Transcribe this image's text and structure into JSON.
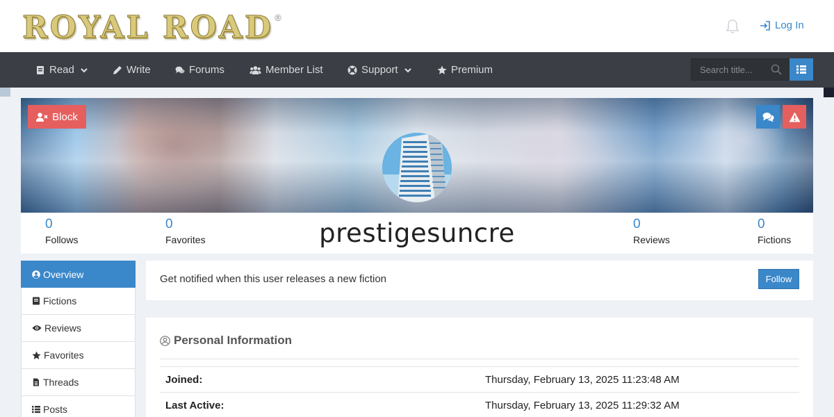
{
  "brand": {
    "logo_text": "ROYAL ROAD",
    "registered": "®"
  },
  "header": {
    "login_label": "Log In"
  },
  "nav": {
    "items": [
      {
        "label": "Read",
        "icon": "book-icon",
        "dropdown": true
      },
      {
        "label": "Write",
        "icon": "pencil-icon",
        "dropdown": false
      },
      {
        "label": "Forums",
        "icon": "comments-icon",
        "dropdown": false
      },
      {
        "label": "Member List",
        "icon": "users-icon",
        "dropdown": false
      },
      {
        "label": "Support",
        "icon": "life-ring-icon",
        "dropdown": true
      },
      {
        "label": "Premium",
        "icon": "star-icon",
        "dropdown": false
      }
    ],
    "search_placeholder": "Search title..."
  },
  "profile": {
    "block_label": "Block",
    "username": "prestigesuncre",
    "stats": {
      "follows": {
        "value": "0",
        "label": "Follows"
      },
      "favorites": {
        "value": "0",
        "label": "Favorites"
      },
      "reviews": {
        "value": "0",
        "label": "Reviews"
      },
      "fictions": {
        "value": "0",
        "label": "Fictions"
      }
    }
  },
  "sidebar": {
    "items": [
      {
        "label": "Overview",
        "icon": "user-circle-icon",
        "active": true
      },
      {
        "label": "Fictions",
        "icon": "book-icon",
        "active": false
      },
      {
        "label": "Reviews",
        "icon": "eye-icon",
        "active": false
      },
      {
        "label": "Favorites",
        "icon": "star-icon",
        "active": false
      },
      {
        "label": "Threads",
        "icon": "file-icon",
        "active": false
      },
      {
        "label": "Posts",
        "icon": "list-icon",
        "active": false
      }
    ]
  },
  "notify": {
    "text": "Get notified when this user releases a new fiction",
    "follow_label": "Follow"
  },
  "personal_info": {
    "title": "Personal Information",
    "rows": [
      {
        "key": "Joined:",
        "value": "Thursday, February 13, 2025 11:23:48 AM"
      },
      {
        "key": "Last Active:",
        "value": "Thursday, February 13, 2025 11:29:32 AM"
      }
    ]
  },
  "colors": {
    "accent": "#3a87c9",
    "danger": "#e55f5f",
    "nav_bg": "#3b3f45"
  }
}
